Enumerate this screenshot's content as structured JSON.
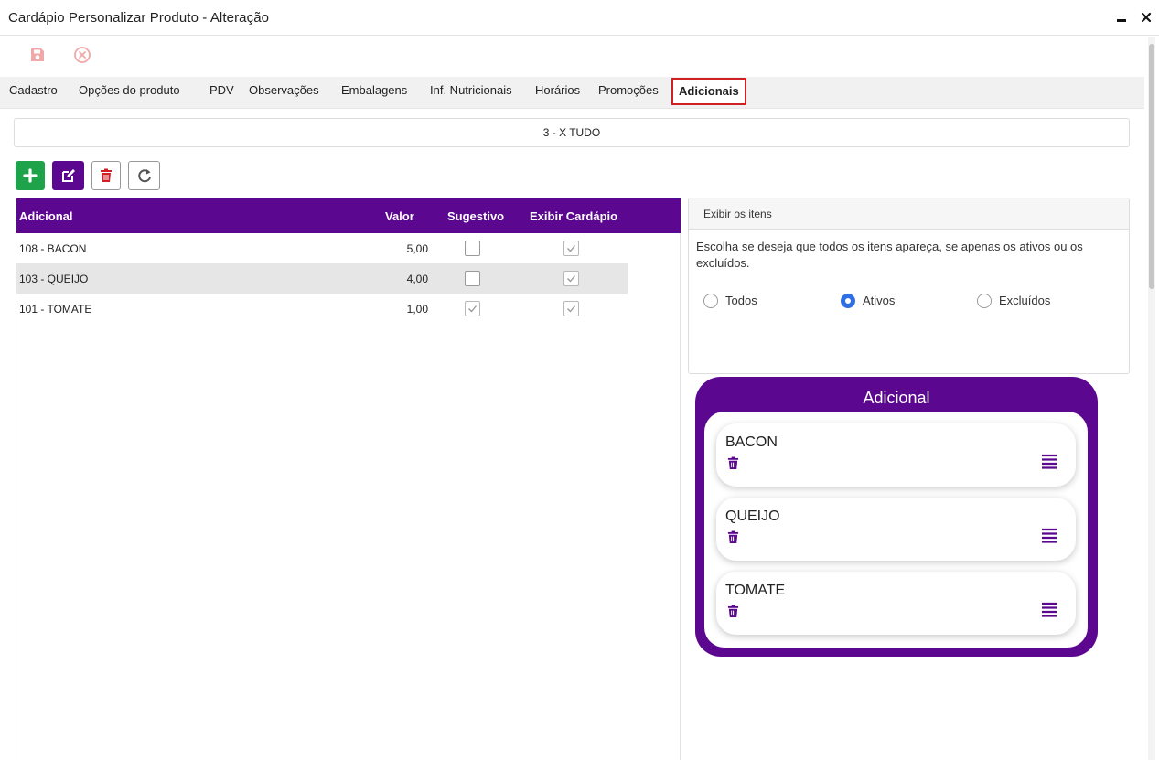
{
  "window": {
    "title": "Cardápio Personalizar Produto - Alteração"
  },
  "toolbar": {
    "save_icon": "save-icon",
    "cancel_icon": "cancel-icon",
    "icon_color": "#f0a8a8"
  },
  "tabs": [
    {
      "label": "Cadastro"
    },
    {
      "label": "Opções do produto"
    },
    {
      "label": "PDV"
    },
    {
      "label": "Observações"
    },
    {
      "label": "Embalagens"
    },
    {
      "label": "Inf. Nutricionais"
    },
    {
      "label": "Horários"
    },
    {
      "label": "Promoções"
    },
    {
      "label": "Adicionais",
      "active": true
    }
  ],
  "product": {
    "name": "3 - X TUDO"
  },
  "actions": {
    "add_icon": "plus-icon",
    "edit_icon": "edit-icon",
    "delete_icon": "trash-icon",
    "refresh_icon": "refresh-icon"
  },
  "grid": {
    "columns": {
      "name": "Adicional",
      "value": "Valor",
      "suggestive": "Sugestivo",
      "show_menu": "Exibir Cardápio"
    },
    "rows": [
      {
        "name": "108 - BACON",
        "value": "5,00",
        "suggestive": false,
        "show_menu": true
      },
      {
        "name": "103 - QUEIJO",
        "value": "4,00",
        "suggestive": false,
        "show_menu": true
      },
      {
        "name": "101 - TOMATE",
        "value": "1,00",
        "suggestive": true,
        "show_menu": true
      }
    ]
  },
  "filter_panel": {
    "title": "Exibir os itens",
    "description": "Escolha se deseja que todos os itens apareça, se apenas os ativos ou os excluídos.",
    "options": [
      {
        "label": "Todos",
        "selected": false
      },
      {
        "label": "Ativos",
        "selected": true
      },
      {
        "label": "Excluídos",
        "selected": false
      }
    ]
  },
  "preview": {
    "title": "Adicional",
    "items": [
      {
        "name": "BACON"
      },
      {
        "name": "QUEIJO"
      },
      {
        "name": "TOMATE"
      }
    ]
  },
  "colors": {
    "brand": "#5b078f",
    "add": "#1ea34a",
    "danger": "#d11f26",
    "radio": "#2f6fe6"
  }
}
